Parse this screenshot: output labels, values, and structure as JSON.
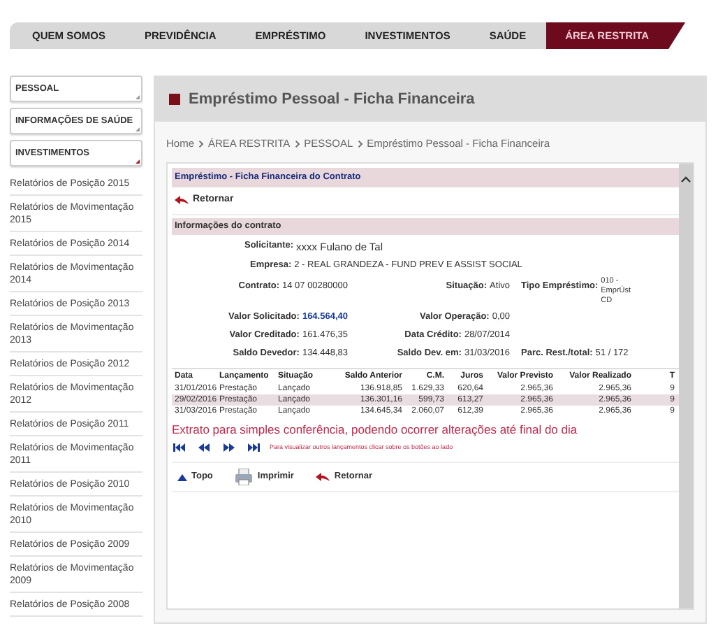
{
  "nav": [
    {
      "label": "QUEM SOMOS",
      "selected": false
    },
    {
      "label": "PREVIDÊNCIA",
      "selected": false
    },
    {
      "label": "EMPRÉSTIMO",
      "selected": false
    },
    {
      "label": "INVESTIMENTOS",
      "selected": false
    },
    {
      "label": "SAÚDE",
      "selected": false
    },
    {
      "label": "ÁREA RESTRITA",
      "selected": true
    }
  ],
  "sidebar": {
    "sections": [
      {
        "label": "PESSOAL",
        "expanded": false
      },
      {
        "label": "INFORMAÇÕES DE SAÚDE",
        "expanded": false
      },
      {
        "label": "INVESTIMENTOS",
        "expanded": true
      }
    ],
    "links": [
      "Relatórios de Posição 2015",
      "Relatórios de Movimentação 2015",
      "Relatórios de Posição 2014",
      "Relatórios de Movimentação 2014",
      "Relatórios de Posição 2013",
      "Relatórios de Movimentação 2013",
      "Relatórios de Posição 2012",
      "Relatórios de Movimentação 2012",
      "Relatórios de Posição 2011",
      "Relatórios de Movimentação 2011",
      "Relatórios de Posição 2010",
      "Relatórios de Movimentação 2010",
      "Relatórios de Posição 2009",
      "Relatórios de Movimentação 2009",
      "Relatórios de Posição 2008"
    ]
  },
  "page_title": "Empréstimo Pessoal - Ficha Financeira",
  "breadcrumb": [
    "Home",
    "ÁREA RESTRITA",
    "PESSOAL",
    "Empréstimo Pessoal - Ficha Financeira"
  ],
  "panel": {
    "title": "Empréstimo - Ficha Financeira do Contrato",
    "back_link": "Retornar",
    "info_title": "Informações do contrato",
    "solicitante": {
      "label": "Solicitante:",
      "value": "xxxx Fulano de Tal"
    },
    "empresa": {
      "label": "Empresa:",
      "value": "2 - REAL GRANDEZA - FUND PREV E ASSIST SOCIAL"
    },
    "grid": [
      [
        {
          "label": "Contrato:",
          "value": "14 07 00280000",
          "emphasis": false
        },
        {
          "label": "Situação:",
          "value": "Ativo",
          "emphasis": false
        },
        {
          "label": "Tipo Empréstimo:",
          "value": "010 - EmprÚst CD",
          "emphasis": false
        }
      ],
      [
        {
          "label": "Valor Solicitado:",
          "value": "164.564,40",
          "emphasis": true
        },
        {
          "label": "Valor Operação:",
          "value": "0,00",
          "emphasis": false
        }
      ],
      [
        {
          "label": "Valor Creditado:",
          "value": "161.476,35",
          "emphasis": false
        },
        {
          "label": "Data Crédito:",
          "value": "28/07/2014",
          "emphasis": false
        }
      ],
      [
        {
          "label": "Saldo Devedor:",
          "value": "134.448,83",
          "emphasis": false
        },
        {
          "label": "Saldo Dev. em:",
          "value": "31/03/2016",
          "emphasis": false
        },
        {
          "label": "Parc. Rest./total:",
          "value": "51 / 172",
          "emphasis": false
        }
      ]
    ],
    "table": {
      "columns": [
        "Data",
        "Lançamento",
        "Situação",
        "Saldo Anterior",
        "C.M.",
        "Juros",
        "Valor Previsto",
        "Valor Realizado",
        "T"
      ],
      "rows": [
        [
          "31/01/2016",
          "Prestação",
          "Lançado",
          "136.918,85",
          "1.629,33",
          "620,64",
          "2.965,36",
          "2.965,36",
          "9"
        ],
        [
          "29/02/2016",
          "Prestação",
          "Lançado",
          "136.301,16",
          "599,73",
          "613,27",
          "2.965,36",
          "2.965,36",
          "9"
        ],
        [
          "31/03/2016",
          "Prestação",
          "Lançado",
          "134.645,34",
          "2.060,07",
          "612,39",
          "2.965,36",
          "2.965,36",
          "9"
        ]
      ]
    },
    "notice": "Extrato para simples conferência, podendo ocorrer alterações até final do dia",
    "pager_hint": "Para visualizar outros lançamentos clicar sobre os botões ao lado",
    "actions": [
      {
        "kind": "top",
        "label": "Topo"
      },
      {
        "kind": "print",
        "label": "Imprimir"
      },
      {
        "kind": "back",
        "label": "Retornar"
      }
    ]
  }
}
